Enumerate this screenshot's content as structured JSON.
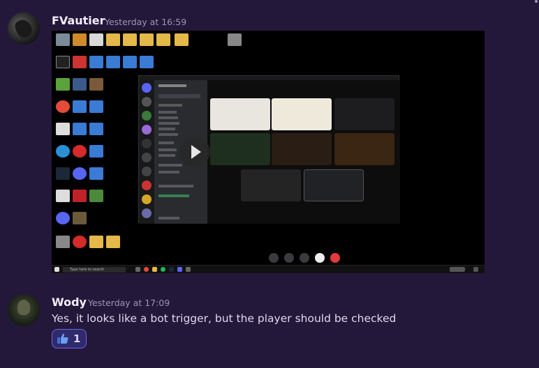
{
  "messages": [
    {
      "author": "FVautier",
      "timestamp": "Yesterday at 16:59",
      "attachment": {
        "type": "image",
        "taskbar_search_placeholder": "Type here to search"
      }
    },
    {
      "author": "Wody",
      "timestamp": "Yesterday at 17:09",
      "text": "Yes, it looks like a bot trigger, but the player should be checked",
      "reactions": [
        {
          "emoji": "thumbs-up",
          "count": "1"
        }
      ]
    }
  ],
  "colors": {
    "background": "#24183a",
    "reaction_bg": "#2f2a6b",
    "reaction_border": "#6d66e0",
    "timestamp": "#9d94b5"
  }
}
